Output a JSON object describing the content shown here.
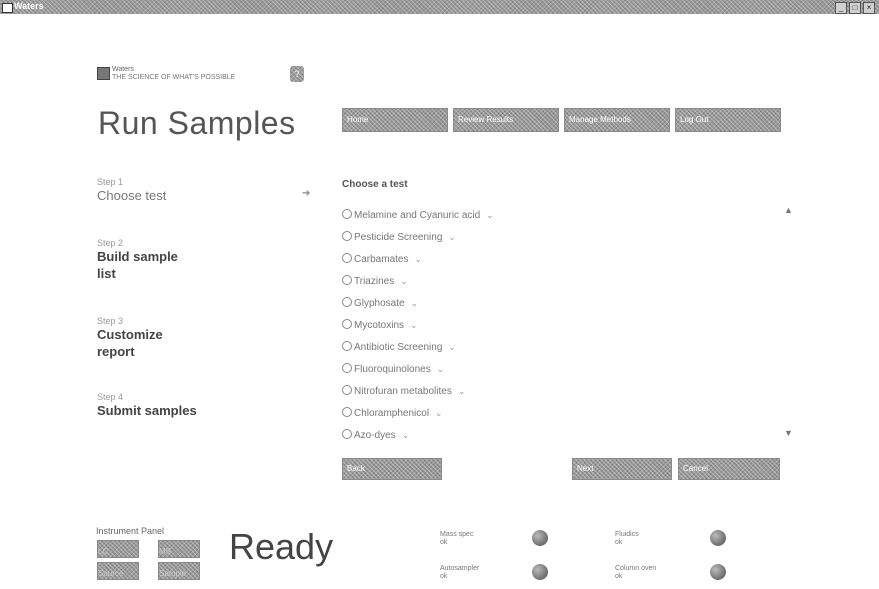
{
  "window": {
    "title": "Waters",
    "buttons": [
      "_",
      "□",
      "×"
    ]
  },
  "header": {
    "logo_line1": "Waters",
    "logo_line2": "THE SCIENCE OF WHAT'S POSSIBLE",
    "help_label": "?",
    "page_title": "Run Samples"
  },
  "toolbar": {
    "buttons": [
      "Home",
      "Review Results",
      "Manage Methods",
      "Log Out"
    ]
  },
  "steps": [
    {
      "label": "Step 1",
      "name": "Choose test"
    },
    {
      "label": "Step 2",
      "name": "Build sample list"
    },
    {
      "label": "Step 3",
      "name": "Customize report"
    },
    {
      "label": "Step 4",
      "name": "Submit samples"
    }
  ],
  "test_panel": {
    "heading": "Choose a test",
    "tests": [
      "Melamine and Cyanuric acid",
      "Pesticide Screening",
      "Carbamates",
      "Triazines",
      "Glyphosate",
      "Mycotoxins",
      "Antibiotic Screening",
      "Fluoroquinolones",
      "Nitrofuran metabolites",
      "Chloramphenicol",
      "Azo-dyes"
    ]
  },
  "bottom_buttons": {
    "left": "Back",
    "right": [
      "Next",
      "Cancel"
    ]
  },
  "instrument": {
    "title": "Instrument Panel",
    "status": "Ready",
    "tiles": [
      "LC",
      "MS",
      "Source",
      "Sample"
    ],
    "indicators": [
      {
        "label": "Mass spec",
        "sub": "ok"
      },
      {
        "label": "Fluidics",
        "sub": "ok"
      },
      {
        "label": "Autosampler",
        "sub": "ok"
      },
      {
        "label": "Column oven",
        "sub": "ok"
      }
    ]
  }
}
